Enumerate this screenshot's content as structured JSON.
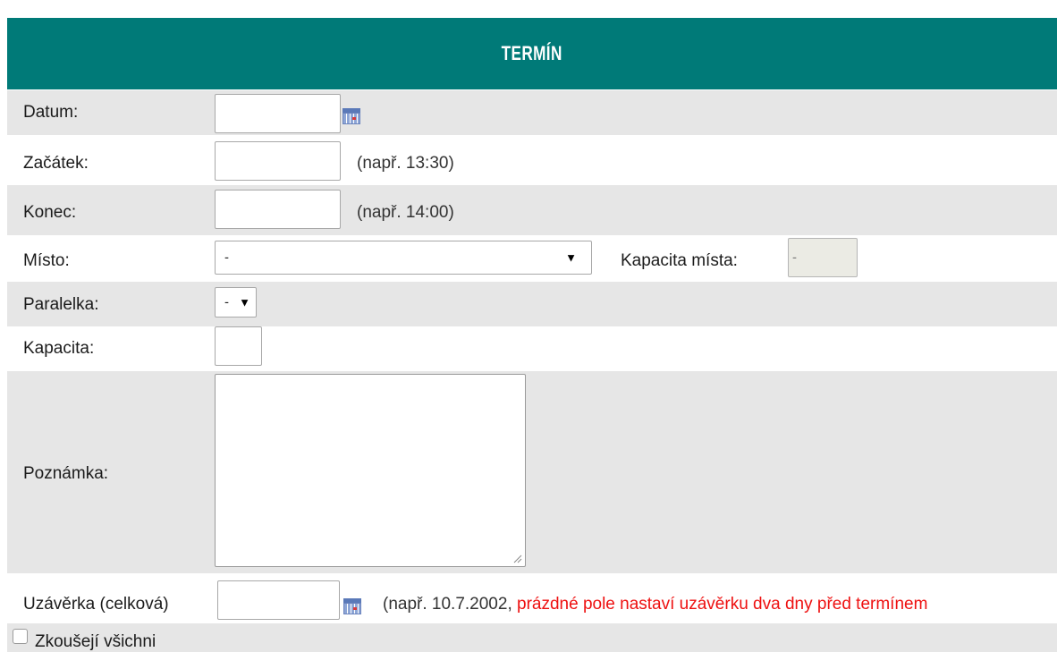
{
  "header": {
    "title": "TERMÍN"
  },
  "fields": {
    "datum": {
      "label": "Datum:",
      "value": ""
    },
    "zacatek": {
      "label": "Začátek:",
      "value": "",
      "hint": "(např. 13:30)"
    },
    "konec": {
      "label": "Konec:",
      "value": "",
      "hint": "(např. 14:00)"
    },
    "misto": {
      "label": "Místo:",
      "selected": "-",
      "capacity_label": "Kapacita místa:",
      "capacity_value": "-"
    },
    "paralelka": {
      "label": "Paralelka:",
      "selected": "-"
    },
    "kapacita": {
      "label": "Kapacita:",
      "value": ""
    },
    "poznamka": {
      "label": "Poznámka:",
      "value": ""
    },
    "uzaverka": {
      "label": "Uzávěrka (celková)",
      "value": "",
      "hint": "(např. 10.7.2002,",
      "warning": "prázdné pole nastaví uzávěrku dva dny před termínem"
    },
    "zkouseji": {
      "label": "Zkoušejí všichni",
      "checked": false
    }
  },
  "icons": {
    "calendar": "calendar-icon",
    "dropdown": "triangle-down",
    "checkbox": "checkbox-unchecked"
  },
  "colors": {
    "header_bg": "#007a78",
    "row_gray": "#e6e6e6",
    "warning": "#ee1111"
  }
}
